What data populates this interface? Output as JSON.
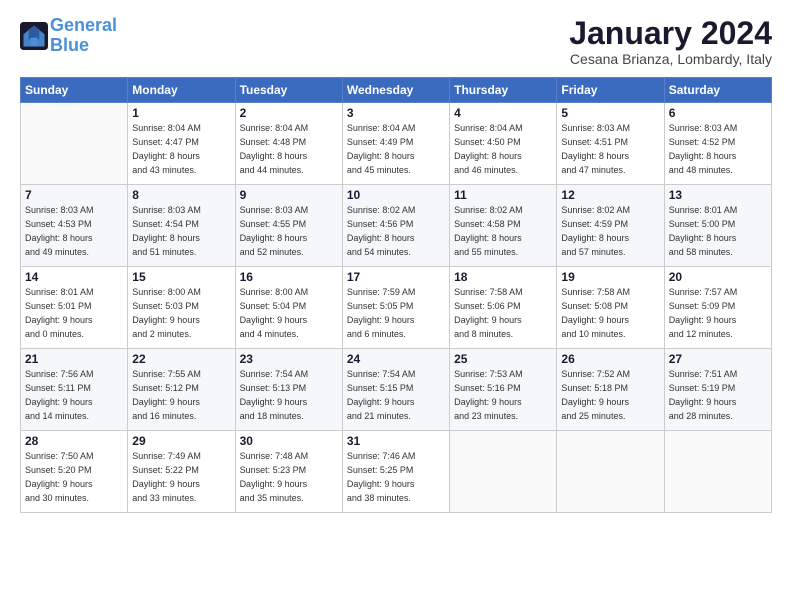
{
  "logo": {
    "line1": "General",
    "line2": "Blue"
  },
  "title": "January 2024",
  "location": "Cesana Brianza, Lombardy, Italy",
  "days_header": [
    "Sunday",
    "Monday",
    "Tuesday",
    "Wednesday",
    "Thursday",
    "Friday",
    "Saturday"
  ],
  "weeks": [
    [
      {
        "day": "",
        "info": ""
      },
      {
        "day": "1",
        "info": "Sunrise: 8:04 AM\nSunset: 4:47 PM\nDaylight: 8 hours\nand 43 minutes."
      },
      {
        "day": "2",
        "info": "Sunrise: 8:04 AM\nSunset: 4:48 PM\nDaylight: 8 hours\nand 44 minutes."
      },
      {
        "day": "3",
        "info": "Sunrise: 8:04 AM\nSunset: 4:49 PM\nDaylight: 8 hours\nand 45 minutes."
      },
      {
        "day": "4",
        "info": "Sunrise: 8:04 AM\nSunset: 4:50 PM\nDaylight: 8 hours\nand 46 minutes."
      },
      {
        "day": "5",
        "info": "Sunrise: 8:03 AM\nSunset: 4:51 PM\nDaylight: 8 hours\nand 47 minutes."
      },
      {
        "day": "6",
        "info": "Sunrise: 8:03 AM\nSunset: 4:52 PM\nDaylight: 8 hours\nand 48 minutes."
      }
    ],
    [
      {
        "day": "7",
        "info": "Sunrise: 8:03 AM\nSunset: 4:53 PM\nDaylight: 8 hours\nand 49 minutes."
      },
      {
        "day": "8",
        "info": "Sunrise: 8:03 AM\nSunset: 4:54 PM\nDaylight: 8 hours\nand 51 minutes."
      },
      {
        "day": "9",
        "info": "Sunrise: 8:03 AM\nSunset: 4:55 PM\nDaylight: 8 hours\nand 52 minutes."
      },
      {
        "day": "10",
        "info": "Sunrise: 8:02 AM\nSunset: 4:56 PM\nDaylight: 8 hours\nand 54 minutes."
      },
      {
        "day": "11",
        "info": "Sunrise: 8:02 AM\nSunset: 4:58 PM\nDaylight: 8 hours\nand 55 minutes."
      },
      {
        "day": "12",
        "info": "Sunrise: 8:02 AM\nSunset: 4:59 PM\nDaylight: 8 hours\nand 57 minutes."
      },
      {
        "day": "13",
        "info": "Sunrise: 8:01 AM\nSunset: 5:00 PM\nDaylight: 8 hours\nand 58 minutes."
      }
    ],
    [
      {
        "day": "14",
        "info": "Sunrise: 8:01 AM\nSunset: 5:01 PM\nDaylight: 9 hours\nand 0 minutes."
      },
      {
        "day": "15",
        "info": "Sunrise: 8:00 AM\nSunset: 5:03 PM\nDaylight: 9 hours\nand 2 minutes."
      },
      {
        "day": "16",
        "info": "Sunrise: 8:00 AM\nSunset: 5:04 PM\nDaylight: 9 hours\nand 4 minutes."
      },
      {
        "day": "17",
        "info": "Sunrise: 7:59 AM\nSunset: 5:05 PM\nDaylight: 9 hours\nand 6 minutes."
      },
      {
        "day": "18",
        "info": "Sunrise: 7:58 AM\nSunset: 5:06 PM\nDaylight: 9 hours\nand 8 minutes."
      },
      {
        "day": "19",
        "info": "Sunrise: 7:58 AM\nSunset: 5:08 PM\nDaylight: 9 hours\nand 10 minutes."
      },
      {
        "day": "20",
        "info": "Sunrise: 7:57 AM\nSunset: 5:09 PM\nDaylight: 9 hours\nand 12 minutes."
      }
    ],
    [
      {
        "day": "21",
        "info": "Sunrise: 7:56 AM\nSunset: 5:11 PM\nDaylight: 9 hours\nand 14 minutes."
      },
      {
        "day": "22",
        "info": "Sunrise: 7:55 AM\nSunset: 5:12 PM\nDaylight: 9 hours\nand 16 minutes."
      },
      {
        "day": "23",
        "info": "Sunrise: 7:54 AM\nSunset: 5:13 PM\nDaylight: 9 hours\nand 18 minutes."
      },
      {
        "day": "24",
        "info": "Sunrise: 7:54 AM\nSunset: 5:15 PM\nDaylight: 9 hours\nand 21 minutes."
      },
      {
        "day": "25",
        "info": "Sunrise: 7:53 AM\nSunset: 5:16 PM\nDaylight: 9 hours\nand 23 minutes."
      },
      {
        "day": "26",
        "info": "Sunrise: 7:52 AM\nSunset: 5:18 PM\nDaylight: 9 hours\nand 25 minutes."
      },
      {
        "day": "27",
        "info": "Sunrise: 7:51 AM\nSunset: 5:19 PM\nDaylight: 9 hours\nand 28 minutes."
      }
    ],
    [
      {
        "day": "28",
        "info": "Sunrise: 7:50 AM\nSunset: 5:20 PM\nDaylight: 9 hours\nand 30 minutes."
      },
      {
        "day": "29",
        "info": "Sunrise: 7:49 AM\nSunset: 5:22 PM\nDaylight: 9 hours\nand 33 minutes."
      },
      {
        "day": "30",
        "info": "Sunrise: 7:48 AM\nSunset: 5:23 PM\nDaylight: 9 hours\nand 35 minutes."
      },
      {
        "day": "31",
        "info": "Sunrise: 7:46 AM\nSunset: 5:25 PM\nDaylight: 9 hours\nand 38 minutes."
      },
      {
        "day": "",
        "info": ""
      },
      {
        "day": "",
        "info": ""
      },
      {
        "day": "",
        "info": ""
      }
    ]
  ]
}
